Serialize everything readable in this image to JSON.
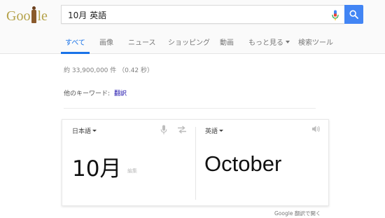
{
  "logo": {
    "pre": "Goo",
    "post": "le",
    "doodle_icon": "doodle-figure-icon"
  },
  "search": {
    "query": "10月 英語",
    "mic_icon": "microphone-icon",
    "button_icon": "search-icon",
    "accent": "#4285f4"
  },
  "tabs": [
    {
      "label": "すべて",
      "active": true
    },
    {
      "label": "画像"
    },
    {
      "label": "ニュース"
    },
    {
      "label": "ショッピング"
    },
    {
      "label": "動画"
    },
    {
      "label": "もっと見る",
      "has_dropdown": true
    },
    {
      "label": "検索ツール"
    }
  ],
  "stats": "約 33,900,000 件 （0.42 秒）",
  "other_keywords": {
    "label": "他のキーワード:",
    "link": "翻訳"
  },
  "translator": {
    "source_lang": "日本語",
    "target_lang": "英語",
    "source_text": "10月",
    "edit_hint": "編集",
    "target_text": "October",
    "icons": [
      "microphone-icon",
      "swap-icon",
      "speaker-icon"
    ]
  },
  "open_in_translate": "Google 翻訳で開く"
}
